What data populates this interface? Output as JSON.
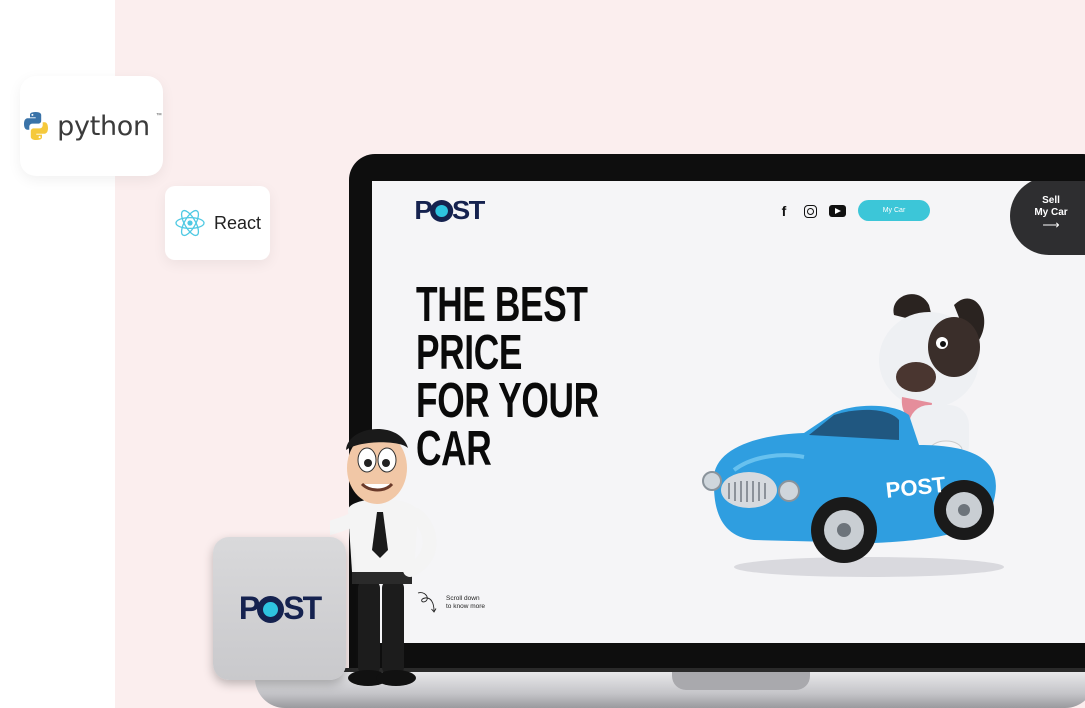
{
  "badges": {
    "python": {
      "label": "python",
      "tm": "™"
    },
    "react": {
      "label": "React"
    }
  },
  "site": {
    "logo": {
      "prefix": "P",
      "suffix": "ST"
    },
    "socials": [
      "facebook-icon",
      "instagram-icon",
      "youtube-icon"
    ],
    "my_car_label": "My Car",
    "sell": {
      "line1": "Sell",
      "line2": "My Car",
      "arrow": "⟶"
    },
    "headline": [
      "THE BEST",
      "PRICE",
      "FOR YOUR",
      "CAR"
    ],
    "scroll_hint": {
      "line1": "Scroll down",
      "line2": "to know more"
    },
    "car_badge": "POST"
  },
  "sign": {
    "prefix": "P",
    "suffix": "ST"
  },
  "colors": {
    "brand_navy": "#15224f",
    "accent_cyan": "#3cc6d8",
    "background_pink": "#fbeeee",
    "car_blue": "#2f9ee0"
  }
}
